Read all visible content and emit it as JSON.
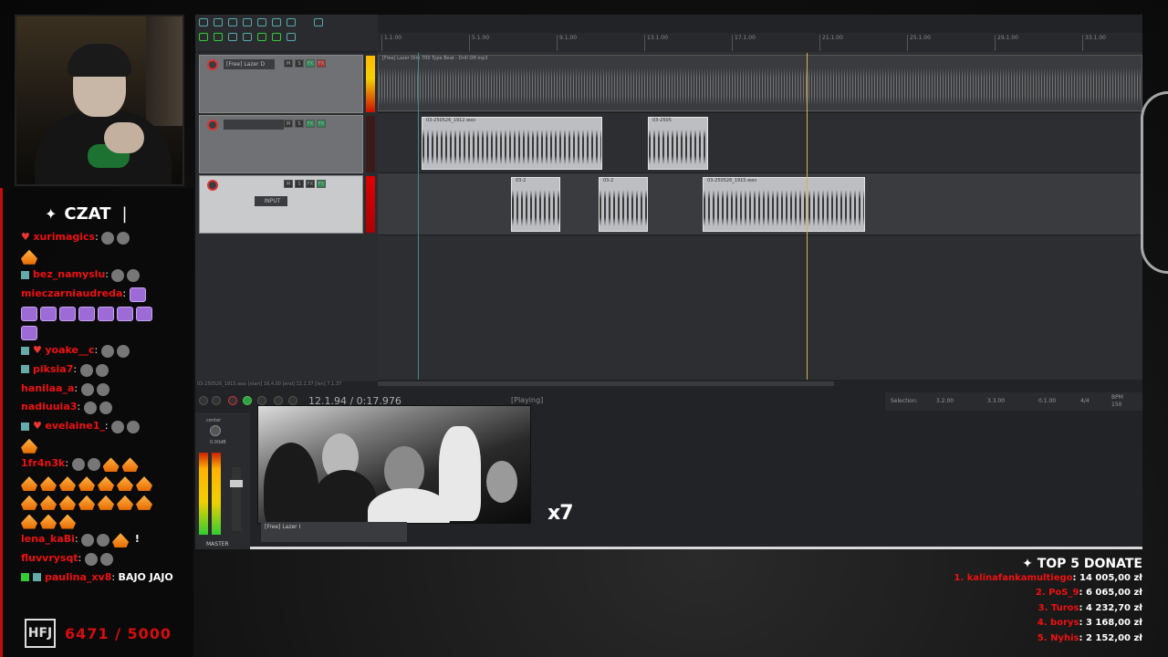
{
  "chat": {
    "title": "CZAT",
    "messages": [
      {
        "user": "xurimagics",
        "text": ""
      },
      {
        "user": "bez_namyslu",
        "text": ""
      },
      {
        "user": "mieczarniaudreda",
        "text": ""
      },
      {
        "user": "yoake__c",
        "text": ""
      },
      {
        "user": "piksia7",
        "text": ""
      },
      {
        "user": "hanilaa_a",
        "text": ""
      },
      {
        "user": "nadiuuia3",
        "text": ""
      },
      {
        "user": "evelaine1_",
        "text": ""
      },
      {
        "user": "1fr4n3k",
        "text": ""
      },
      {
        "user": "lena_kaBi",
        "text": ""
      },
      {
        "user": "fluvvrysqt",
        "text": ""
      },
      {
        "user": "paulina_xv8",
        "text": "BAJO JAJO"
      }
    ],
    "goal": {
      "logo": "HFJ",
      "count": "6471 / 5000"
    }
  },
  "daw": {
    "tracks": [
      {
        "name": "[Free] Lazer D"
      },
      {
        "name": ""
      },
      {
        "name": "INPUT"
      }
    ],
    "items": {
      "track1": "[Free] Lazer Dim 700 Type Beat - Drill Off.mp3",
      "track2a": "03-250526_1912.wav",
      "track2b": "03-2505",
      "track3a": "03-2",
      "track3b": "03-2",
      "track3c": "03-250526_1915.wav"
    },
    "ruler_ticks": [
      "1.1.00",
      "5.1.00",
      "9.1.00",
      "13.1.00",
      "17.1.00",
      "21.1.00",
      "25.1.00",
      "29.1.00",
      "33.1.00"
    ],
    "status_path": "03-250526_1915.wav [start] 16.4.00 [end] 13.1.37 [len] 7.1.37",
    "transport": {
      "timecode": "12.1.94 / 0:17.976",
      "state": "[Playing]",
      "selection_label": "Selection:",
      "sel_start": "3.2.00",
      "sel_end": "3.3.00",
      "sel_len": "0.1.00",
      "time_sig": "4/4",
      "bpm_label": "BPM",
      "bpm": "150"
    },
    "mixer": {
      "pan": "center",
      "vol": "0.00dB",
      "master": "MASTER",
      "track": "[Free] Lazer I"
    }
  },
  "overlay": {
    "multiplier": "x7"
  },
  "donate": {
    "title": "TOP 5 DONATE",
    "rows": [
      {
        "rank": "1. kalinafankamultiego",
        "amount": "14 005,00 zł"
      },
      {
        "rank": "2. PoS_9",
        "amount": "6 065,00 zł"
      },
      {
        "rank": "3. Turos",
        "amount": "4 232,70 zł"
      },
      {
        "rank": "4. borys",
        "amount": "3 168,00 zł"
      },
      {
        "rank": "5. Nyhis",
        "amount": "2 152,00 zł"
      }
    ]
  },
  "colors": {
    "accent_red": "#e11111",
    "chat_border": "#c20d0d",
    "play_green": "#2ea043"
  }
}
